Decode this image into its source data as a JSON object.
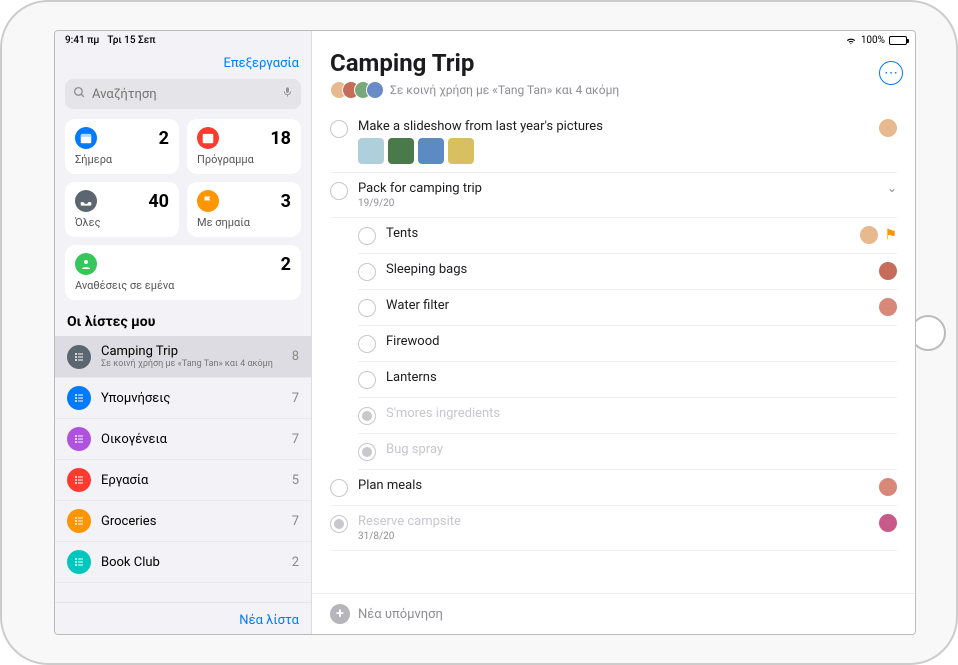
{
  "status": {
    "time": "9:41 πμ",
    "date": "Τρι 15 Σεπ",
    "battery": "100%"
  },
  "sidebar": {
    "edit": "Επεξεργασία",
    "search_placeholder": "Αναζήτηση",
    "cards": {
      "today": {
        "label": "Σήμερα",
        "count": "2",
        "color": "#007aff"
      },
      "schedule": {
        "label": "Πρόγραμμα",
        "count": "18",
        "color": "#ff3b30"
      },
      "all": {
        "label": "Όλες",
        "count": "40",
        "color": "#5b6670"
      },
      "flagged": {
        "label": "Με σημαία",
        "count": "3",
        "color": "#ff9500"
      },
      "assigned": {
        "label": "Αναθέσεις σε εμένα",
        "count": "2",
        "color": "#34c759"
      }
    },
    "section_title": "Οι λίστες μου",
    "lists": [
      {
        "name": "Camping Trip",
        "sub": "Σε κοινή χρήση με «Tang Tan» και 4 ακόμη",
        "count": "8",
        "color": "#5b6670",
        "selected": true
      },
      {
        "name": "Υπομνήσεις",
        "count": "7",
        "color": "#007aff"
      },
      {
        "name": "Οικογένεια",
        "count": "7",
        "color": "#af52de"
      },
      {
        "name": "Εργασία",
        "count": "5",
        "color": "#ff3b30"
      },
      {
        "name": "Groceries",
        "count": "7",
        "color": "#ff9500"
      },
      {
        "name": "Book Club",
        "count": "2",
        "color": "#00c7be"
      }
    ],
    "new_list": "Νέα λίστα"
  },
  "main": {
    "title": "Camping Trip",
    "shared_with": "Σε κοινή χρήση με «Tang Tan» και 4 ακόμη",
    "share_faces": [
      "#e8b98f",
      "#c76b5a",
      "#7aa87a",
      "#6b8bc7"
    ],
    "reminders": [
      {
        "title": "Make a slideshow from last year's pictures",
        "thumbs": [
          "#b0cfdd",
          "#4a7a4a",
          "#5b8bc0",
          "#d8c060"
        ],
        "avatar": "#e8b98f"
      },
      {
        "title": "Pack for camping trip",
        "date": "19/9/20",
        "expandable": true,
        "subtasks": [
          {
            "title": "Tents",
            "avatar": "#e8b98f",
            "flagged": true
          },
          {
            "title": "Sleeping bags",
            "avatar": "#c76b5a"
          },
          {
            "title": "Water filter",
            "avatar": "#d88878"
          },
          {
            "title": "Firewood"
          },
          {
            "title": "Lanterns"
          },
          {
            "title": "S'mores ingredients",
            "done": true
          },
          {
            "title": "Bug spray",
            "done": true
          }
        ]
      },
      {
        "title": "Plan meals",
        "avatar": "#d88878"
      },
      {
        "title": "Reserve campsite",
        "date": "31/8/20",
        "done": true,
        "avatar": "#c85a8a"
      }
    ],
    "new_reminder": "Νέα υπόμνηση"
  }
}
